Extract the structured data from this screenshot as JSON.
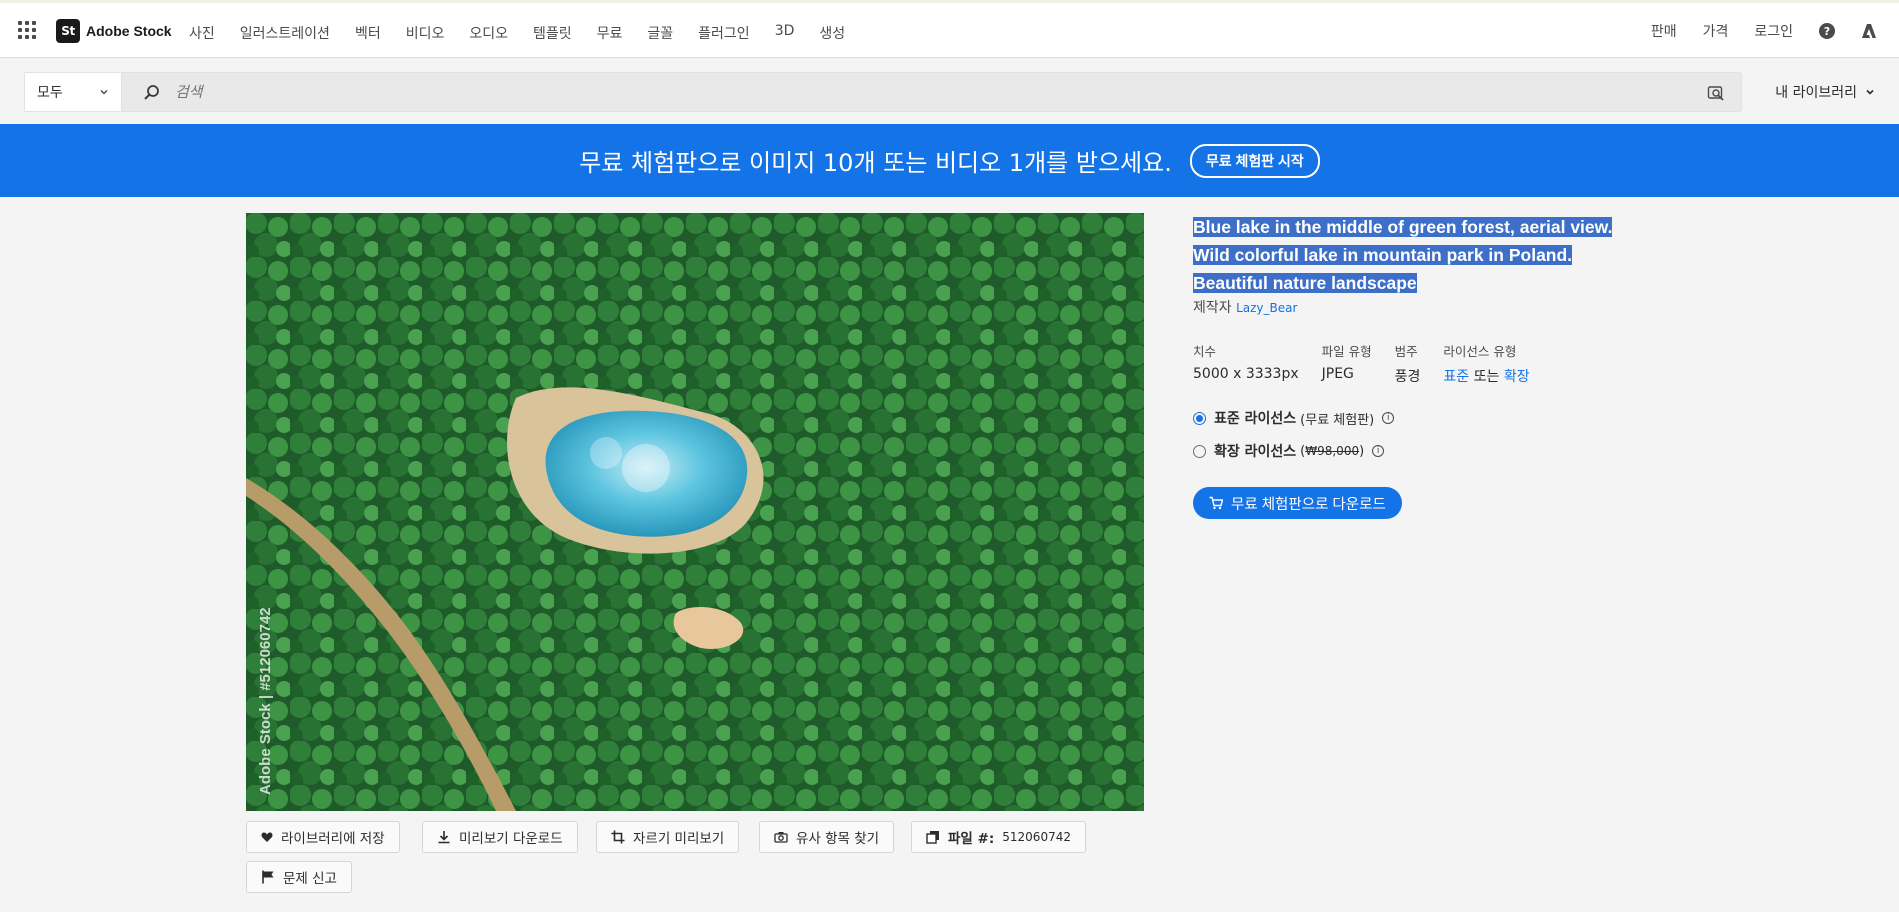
{
  "nav": {
    "logo_mark": "St",
    "logo_text": "Adobe Stock",
    "items": [
      "사진",
      "일러스트레이션",
      "벡터",
      "비디오",
      "오디오",
      "템플릿",
      "무료",
      "글꼴",
      "플러그인",
      "3D",
      "생성"
    ],
    "right": {
      "sell": "판매",
      "pricing": "가격",
      "login": "로그인"
    }
  },
  "search": {
    "filter": "모두",
    "placeholder": "검색",
    "my_library": "내 라이브러리"
  },
  "banner": {
    "text": "무료 체험판으로 이미지 10개 또는 비디오 1개를 받으세요.",
    "button": "무료 체험판 시작",
    "color": "#1473e6"
  },
  "image": {
    "watermark": "Adobe Stock | #512060742"
  },
  "actions": {
    "save": "라이브러리에 저장",
    "download_preview": "미리보기 다운로드",
    "crop_preview": "자르기 미리보기",
    "find_similar": "유사 항목 찾기",
    "file_label": "파일 #:",
    "file_number": "512060742",
    "report": "문제 신고"
  },
  "details": {
    "title_line1": "Blue lake in the middle of green forest, aerial view.",
    "title_line2": "Wild colorful lake in mountain park in Poland.",
    "title_line3": "Beautiful nature landscape",
    "author_prefix": "제작자",
    "author": "Lazy_Bear",
    "meta": {
      "size_label": "치수",
      "size_value": "5000 x 3333px",
      "type_label": "파일 유형",
      "type_value": "JPEG",
      "category_label": "범주",
      "category_value": "풍경",
      "license_label": "라이선스 유형",
      "license_std": "표준",
      "license_or": "또는",
      "license_ext": "확장"
    },
    "licenses": {
      "standard_name": "표준 라이선스",
      "standard_note": "(무료 체험판)",
      "extended_name": "확장 라이선스",
      "extended_price_open": "(",
      "extended_price": "₩98,000",
      "extended_price_close": ")"
    },
    "download_button": "무료 체험판으로 다운로드"
  }
}
